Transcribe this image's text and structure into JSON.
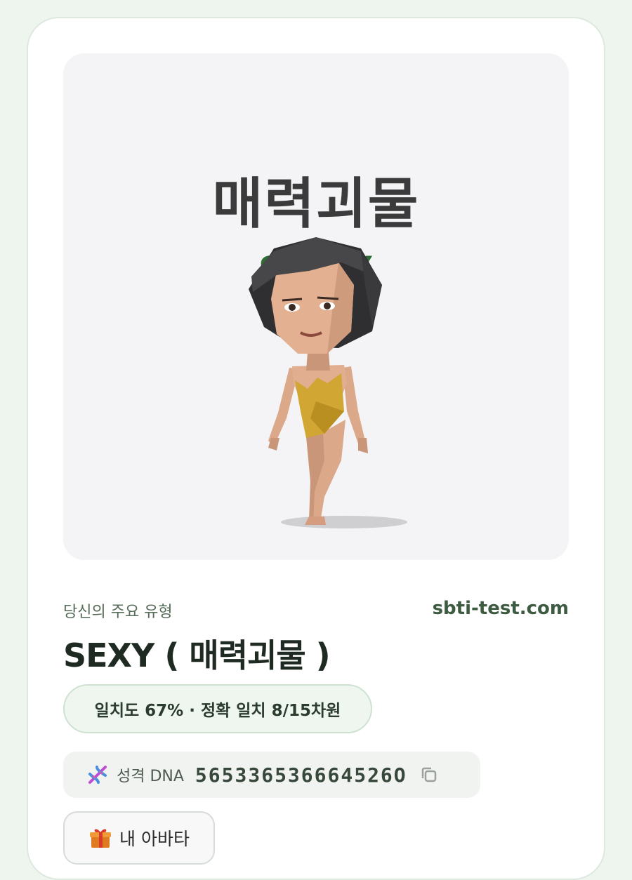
{
  "hero": {
    "title_ko": "매력괴물",
    "title_en": "SEXY",
    "character_icon": "low-poly-character-illustration"
  },
  "result": {
    "primary_label": "당신의 주요 유형",
    "site": "sbti-test.com",
    "type_title": "SEXY ( 매력괴물 )",
    "match_text": "일치도 67% · 정확 일치 8/15차원"
  },
  "dna": {
    "icon": "dna-icon",
    "label": "성격 DNA",
    "code": "565336536664526O",
    "copy_icon": "copy-icon"
  },
  "avatar": {
    "icon": "gift-icon",
    "label": "내 아바타"
  },
  "colors": {
    "accent_green": "#2f6b35",
    "background": "#eef5ef"
  }
}
